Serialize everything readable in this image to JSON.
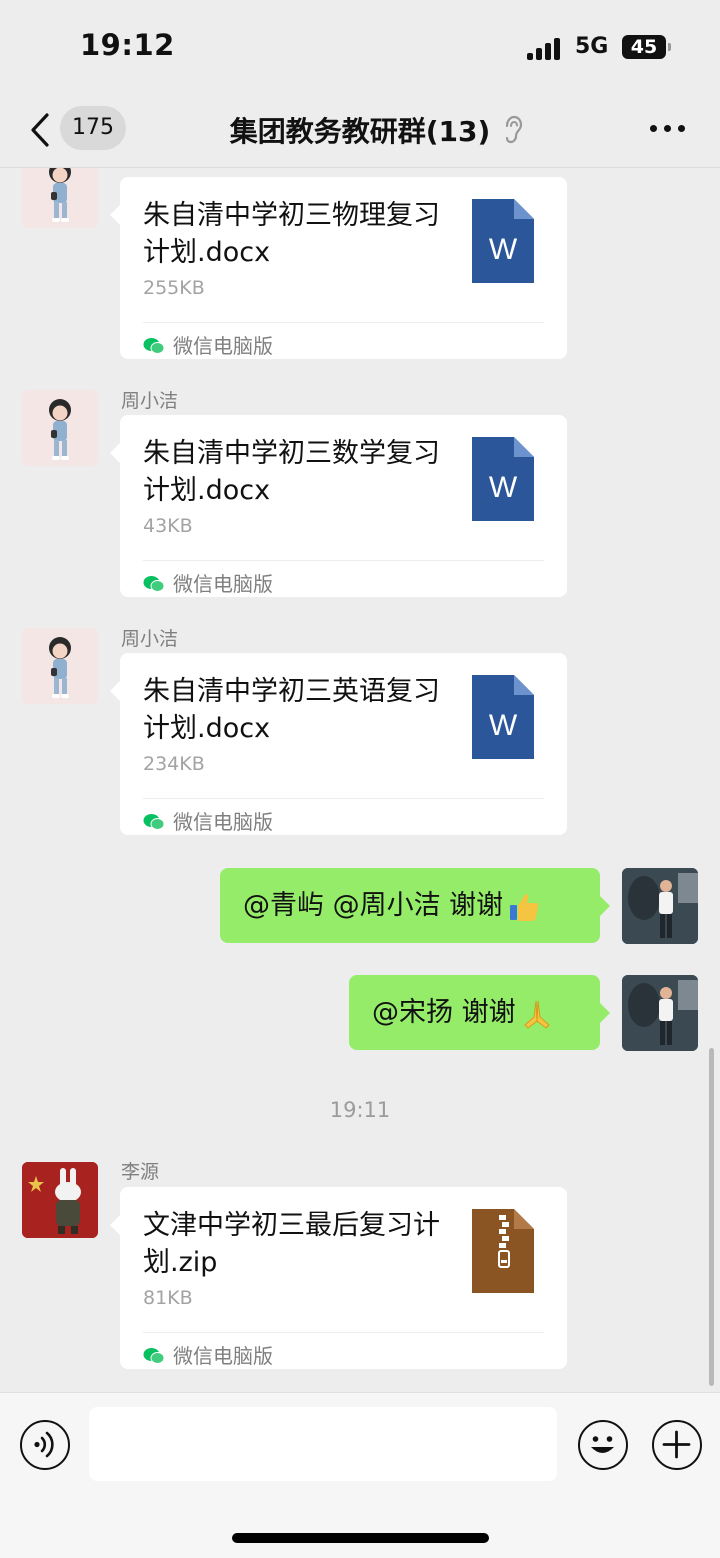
{
  "status_bar": {
    "time": "19:12",
    "network": "5G",
    "battery": "45"
  },
  "nav": {
    "unread_count": "175",
    "title": "集团教务教研群(13)"
  },
  "messages": [
    {
      "type": "file",
      "direction": "incoming",
      "sender": "",
      "file_name": "朱自清中学初三物理复习计划.docx",
      "file_size": "255KB",
      "file_type": "word-doc-icon",
      "source": "微信电脑版"
    },
    {
      "type": "file",
      "direction": "incoming",
      "sender": "周小洁",
      "file_name": "朱自清中学初三数学复习计划.docx",
      "file_size": "43KB",
      "file_type": "word-doc-icon",
      "source": "微信电脑版"
    },
    {
      "type": "file",
      "direction": "incoming",
      "sender": "周小洁",
      "file_name": "朱自清中学初三英语复习计划.docx",
      "file_size": "234KB",
      "file_type": "word-doc-icon",
      "source": "微信电脑版"
    },
    {
      "type": "text",
      "direction": "outgoing",
      "text": "@青屿 @周小洁 谢谢",
      "emoji": "thumbs-up-icon"
    },
    {
      "type": "text",
      "direction": "outgoing",
      "text": "@宋扬 谢谢",
      "emoji": "folded-hands-icon"
    },
    {
      "type": "time",
      "text": "19:11"
    },
    {
      "type": "file",
      "direction": "incoming",
      "sender": "李源",
      "file_name": "文津中学初三最后复习计划.zip",
      "file_size": "81KB",
      "file_type": "zip-archive-icon",
      "source": "微信电脑版"
    }
  ],
  "input": {
    "value": "",
    "placeholder": ""
  },
  "colors": {
    "background": "#ededed",
    "bubble_outgoing": "#95ec69",
    "word_icon": "#2b579a",
    "zip_icon": "#8b5523",
    "wechat_green": "#07c160"
  }
}
